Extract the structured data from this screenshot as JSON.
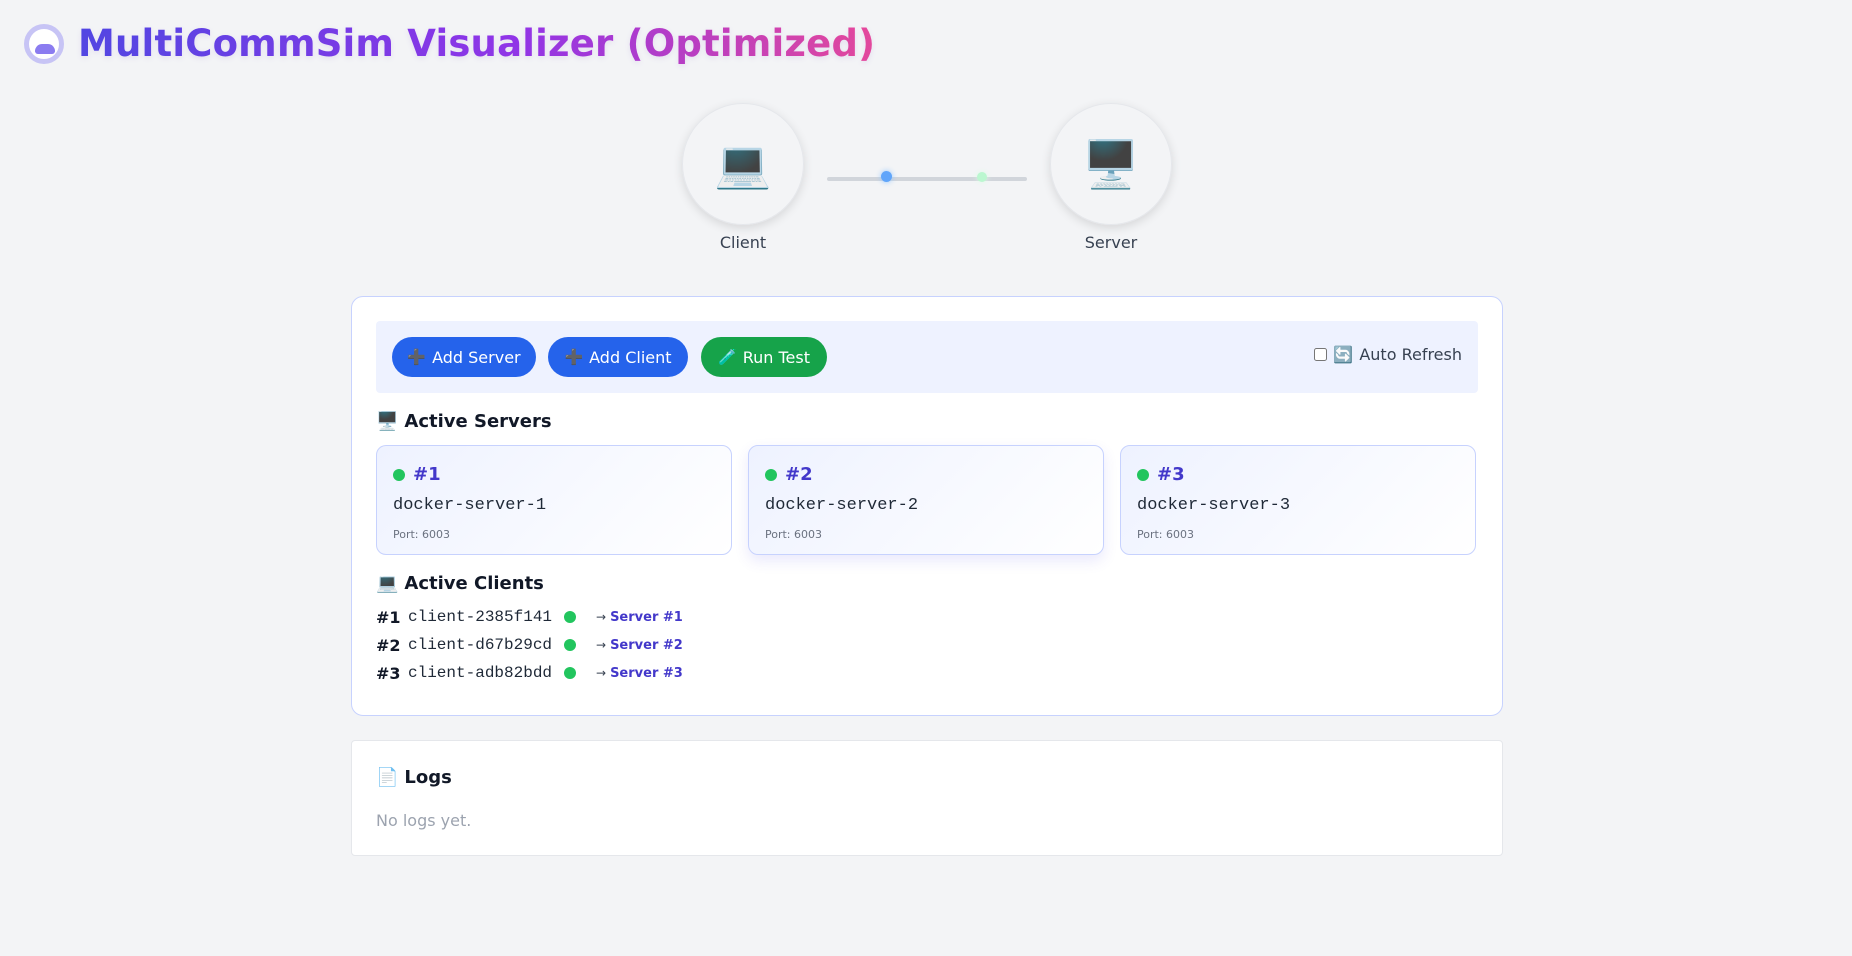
{
  "app": {
    "title": "MultiCommSim Visualizer (Optimized)"
  },
  "diagram": {
    "client_label": "Client",
    "client_icon": "💻",
    "server_label": "Server",
    "server_icon": "🖥️"
  },
  "toolbar": {
    "add_server": {
      "icon": "➕",
      "label": "Add Server"
    },
    "add_client": {
      "icon": "➕",
      "label": "Add Client"
    },
    "run_test": {
      "icon": "🧪",
      "label": "Run Test"
    },
    "auto_refresh": {
      "icon": "🔄",
      "label": "Auto Refresh",
      "checked": false
    }
  },
  "servers_section": {
    "icon": "🖥️",
    "title": "Active Servers"
  },
  "servers": [
    {
      "num": "#1",
      "name": "docker-server-1",
      "port": "Port: 6003",
      "status_color": "#22c55e"
    },
    {
      "num": "#2",
      "name": "docker-server-2",
      "port": "Port: 6003",
      "status_color": "#22c55e"
    },
    {
      "num": "#3",
      "name": "docker-server-3",
      "port": "Port: 6003",
      "status_color": "#22c55e"
    }
  ],
  "clients_section": {
    "icon": "💻",
    "title": "Active Clients"
  },
  "clients": [
    {
      "num": "#1",
      "id": "client-2385f141",
      "arrow": "→",
      "target": "Server #1"
    },
    {
      "num": "#2",
      "id": "client-d67b29cd",
      "arrow": "→",
      "target": "Server #2"
    },
    {
      "num": "#3",
      "id": "client-adb82bdd",
      "arrow": "→",
      "target": "Server #3"
    }
  ],
  "logs": {
    "icon": "📄",
    "title": "Logs",
    "empty_text": "No logs yet."
  },
  "colors": {
    "primary_button": "#2563eb",
    "success_button": "#16a34a",
    "status_online": "#22c55e",
    "accent_text": "#4338ca"
  }
}
